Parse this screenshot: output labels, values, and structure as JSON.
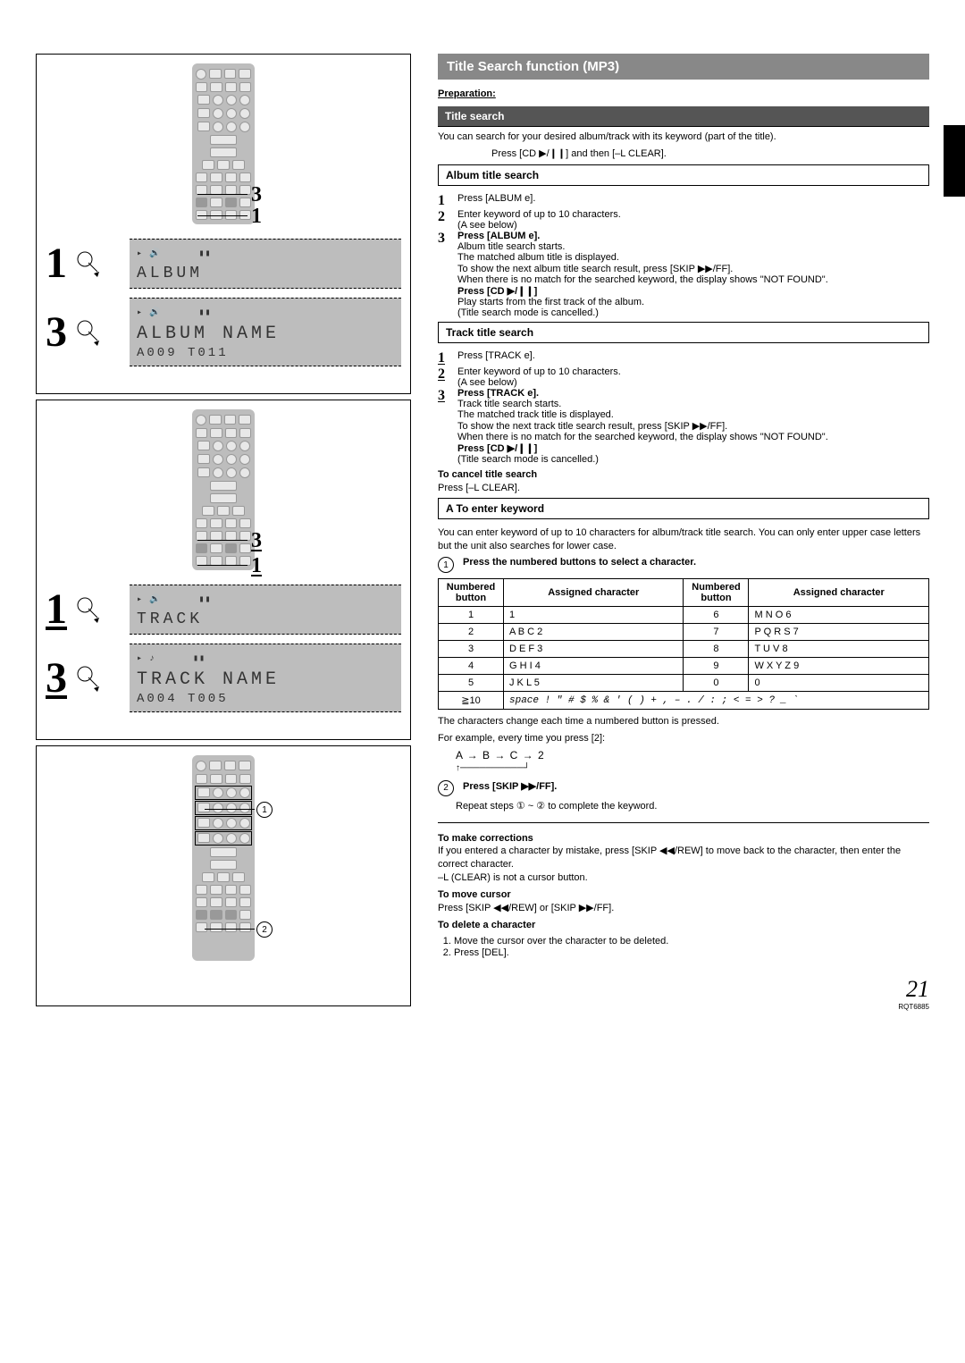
{
  "left": {
    "remote_labels": {
      "r1_num": "3",
      "r1_num2": "1",
      "r2_num": "3",
      "r2_num2": "1"
    },
    "album_block": {
      "step1_num": "1",
      "step3_num": "3",
      "lcd1_line": "ALBUM",
      "lcd2_line1": "ALBUM  NAME",
      "lcd2_line2": "A009   T011"
    },
    "track_block": {
      "step1_num": "1",
      "step3_num": "3",
      "lcd1_line": "TRACK",
      "lcd2_line1": "TRACK  NAME",
      "lcd2_line2": "A004   T005"
    },
    "circ1": "1",
    "circ2": "2"
  },
  "right": {
    "title": "Title Search function (MP3)",
    "prep_head": "Preparation:",
    "sub_search": "Title search",
    "intro": "You can search for your desired album/track with its keyword (part of the title).",
    "prep_body": "Press [CD ▶/❙❙] and then [–L  CLEAR].",
    "album_box": "Album title search",
    "step_a1": "Press [ALBUM e].",
    "step_a2": "Enter keyword of up to 10 characters.",
    "step_a2_sub": "(A  see below)",
    "step_a3": "Press [ALBUM e].",
    "album_result": "Album title search starts.\nThe matched album title is displayed.\nTo show the next album title search result, press [SKIP ▶▶/FF].\nWhen there is no match for the searched keyword, the display shows \"NOT FOUND\".",
    "album_play_head": "Press [CD ▶/❙❙]",
    "album_play_body": "Play starts from the first track of the album.\n(Title search mode is cancelled.)",
    "track_box": "Track title search",
    "step_t1": "Press [TRACK e].",
    "step_t2": "Enter keyword of up to 10 characters.",
    "step_t2_sub": "(A  see below)",
    "step_t3": "Press [TRACK e].",
    "track_result": "Track title search starts.\nThe matched track title is displayed.\nTo show the next track title search result, press [SKIP ▶▶/FF].\nWhen there is no match for the searched keyword, the display shows \"NOT FOUND\".",
    "track_play_head": "Press [CD ▶/❙❙]",
    "track_play_body": "(Title search mode is cancelled.)",
    "cancel_head": "To cancel title search",
    "cancel_body": "Press [–L  CLEAR].",
    "enter_box": "A To enter keyword",
    "enter_intro": "You can enter keyword of up to 10 characters for album/track title search. You can only enter upper case letters but the unit also searches for lower case.",
    "enter_step1": "Press the numbered buttons to select a character.",
    "table": {
      "h1": "Numbered button",
      "h2": "Assigned character",
      "rows": [
        [
          "1",
          "1",
          "6",
          "M N O 6"
        ],
        [
          "2",
          "A B C 2",
          "7",
          "P Q R S 7"
        ],
        [
          "3",
          "D E F 3",
          "8",
          "T U V 8"
        ],
        [
          "4",
          "G H I 4",
          "9",
          "W X Y Z 9"
        ],
        [
          "5",
          "J K L 5",
          "0",
          "0"
        ]
      ],
      "last_left": "≧10",
      "last_right": "space ! \" # $ % & ' ( )  + , –  . / : ; < =  >  ? _   `"
    },
    "char_change": "The characters change each time a numbered button is pressed.",
    "char_example": "For example, every time you press [2]:",
    "seq": "A → B → C → 2",
    "enter_step2": "Press [SKIP ▶▶/FF].",
    "repeat_note": "Repeat steps ① ~ ② to complete the keyword.",
    "corr_head": "To make corrections",
    "corr_body": "If you entered a character by mistake, press [SKIP ◀◀/REW] to move back to the character, then enter the correct character.",
    "corr_note": "–L (CLEAR) is not a cursor button.",
    "cursor_head": "To move cursor",
    "cursor_body": "Press [SKIP ◀◀/REW] or [SKIP ▶▶/FF].",
    "delete_head": "To delete a character",
    "delete_1": "Move the cursor over the character to be deleted.",
    "delete_2": "Press [DEL].",
    "page_num": "21",
    "doc_code": "RQT6885"
  }
}
